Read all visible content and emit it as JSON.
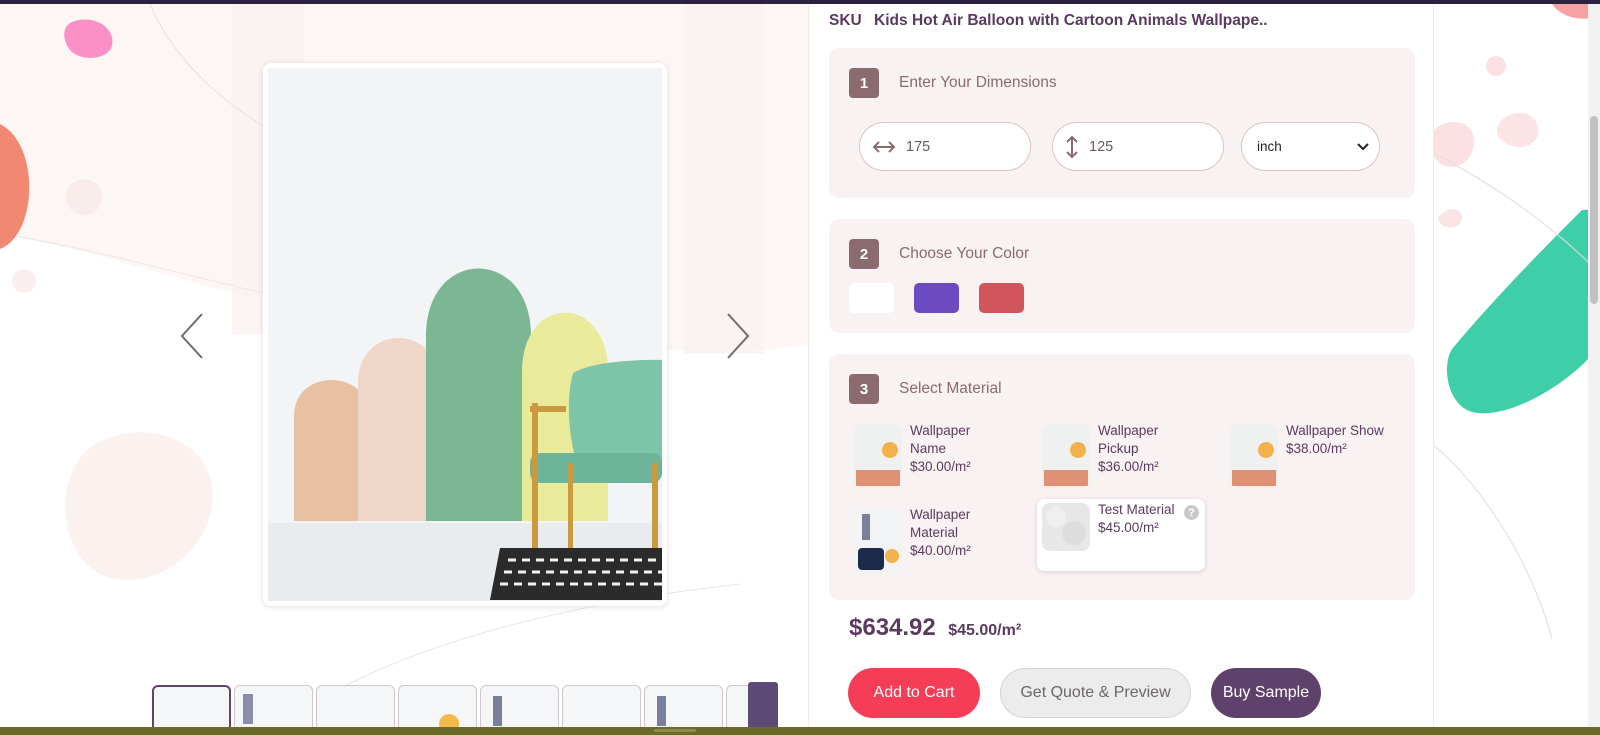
{
  "product": {
    "sku_label": "SKU",
    "name": "Kids Hot Air Balloon with Cartoon Animals Wallpape.."
  },
  "gallery": {
    "prev_icon": "chevron-left-icon",
    "next_icon": "chevron-right-icon",
    "thumbnail_count_visible": 8
  },
  "steps": {
    "dimensions": {
      "number": "1",
      "title": "Enter Your Dimensions",
      "width_value": "175",
      "height_value": "125",
      "unit_selected": "inch"
    },
    "color": {
      "number": "2",
      "title": "Choose Your Color",
      "swatches": [
        "#ffffff",
        "#6c4abf",
        "#d0555c"
      ]
    },
    "material": {
      "number": "3",
      "title": "Select Material",
      "items": [
        {
          "name": "Wallpaper Name",
          "price": "$30.00/m²"
        },
        {
          "name": "Wallpaper Pickup",
          "price": "$36.00/m²"
        },
        {
          "name": "Wallpaper Show",
          "price": "$38.00/m²"
        },
        {
          "name": "Wallpaper Material",
          "price": "$40.00/m²"
        },
        {
          "name": "Test Material",
          "price": "$45.00/m²"
        }
      ],
      "help_glyph": "?"
    }
  },
  "pricing": {
    "total": "$634.92",
    "rate": "$45.00/m²"
  },
  "actions": {
    "add_to_cart": "Add to Cart",
    "quote": "Get Quote & Preview",
    "sample": "Buy Sample"
  },
  "colors": {
    "accent_red": "#f53d57",
    "accent_purple": "#5e426b",
    "step_badge": "#8b6b6e",
    "section_bg": "#f9f2f2"
  }
}
